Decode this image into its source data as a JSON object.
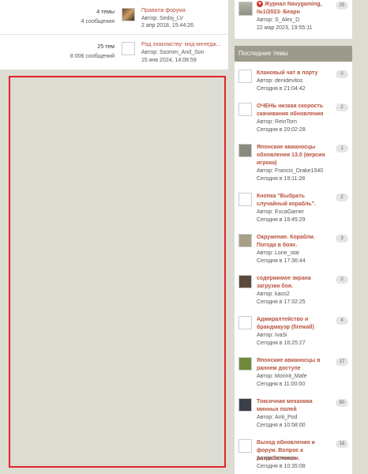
{
  "forum_rows": [
    {
      "stat_topics": "4 темы",
      "stat_posts": "4 сообщения",
      "last_title": "Правила форума",
      "last_author": "Автор: Sedoj_LV",
      "last_date": "2 апр 2018, 15:44:26",
      "avatar_icon": "user-avatar-icon"
    },
    {
      "stat_topics": "25 тем",
      "stat_posts": "8 006 сообщений",
      "last_title": "Рад знакомству: мод-менедж...",
      "last_author": "Автор: Ssomm_And_Son",
      "last_date": "15 янв 2024, 14:08:59",
      "avatar_icon": "user-avatar-icon"
    }
  ],
  "sidebar": {
    "top_card": {
      "title_line1": "Журнал Navygaming,",
      "title_line2": "№1/2023- Беарн",
      "author": "Автор: S_Alex_D",
      "date": "22 мар 2023, 19:55:11",
      "count": "25",
      "mark_icon": "pinned-mark-icon"
    },
    "latest_header": "Последние темы",
    "latest": [
      {
        "title": "Клановый чат в порту",
        "author": "Автор: denidevitos",
        "date": "Сегодня в 21:04:42",
        "count": "0",
        "avatar_color": "#ffffff"
      },
      {
        "title": "ОЧЕНЬ низкая скорость скачивания обновления",
        "author": "Автор: ReinTorn",
        "date": "Сегодня в 20:02:28",
        "count": "2",
        "avatar_color": "#ffffff"
      },
      {
        "title": "Японские авианосцы обновления 13.0 (версия игрока)",
        "author": "Автор: Francis_Drake1540",
        "date": "Сегодня в 19:11:28",
        "count": "1",
        "avatar_color": "#8a8a80"
      },
      {
        "title": "Кнопка \"Выбрать случайный корабль\".",
        "author": "Автор: ExcaGamer",
        "date": "Сегодня в 18:45:29",
        "count": "2",
        "avatar_color": "#ffffff"
      },
      {
        "title": "Окружение. Корабли. Погода в боях.",
        "author": "Автор: Lone_star",
        "date": "Сегодня в 17:36:44",
        "count": "3",
        "avatar_color": "#a89f88"
      },
      {
        "title": "содержимое экрана загрузки боя.",
        "author": "Автор: kaos2",
        "date": "Сегодня в 17:32:25",
        "count": "2",
        "avatar_color": "#5b4a3b"
      },
      {
        "title": "Адмиралтейство и брандмауэр (firewall)",
        "author": "Автор: IvaSi",
        "date": "Сегодня в 16:25:27",
        "count": "4",
        "avatar_color": "#ffffff"
      },
      {
        "title": "Японские авианосцы в раннем доступе",
        "author": "Автор: Morinit_Mafe",
        "date": "Сегодня в 11:00:00",
        "count": "17",
        "avatar_color": "#6f8a3a"
      },
      {
        "title": "Токсичная механика минных полей",
        "author": "Автор: Anti_Pod",
        "date": "Сегодня в 10:58:00",
        "count": "80",
        "avatar_color": "#3a3f4a"
      },
      {
        "title": "Выход обновления и форум. Вопрос к разработчикам.",
        "author": "Автор: novozon",
        "date": "Сегодня в 10:35:08",
        "count": "18",
        "avatar_color": "#ffffff"
      }
    ]
  },
  "colors": {
    "link": "#b8523c",
    "header_bg": "#9c9a8a",
    "page_bg": "#dddcd3",
    "highlight_border": "#e2242b"
  }
}
